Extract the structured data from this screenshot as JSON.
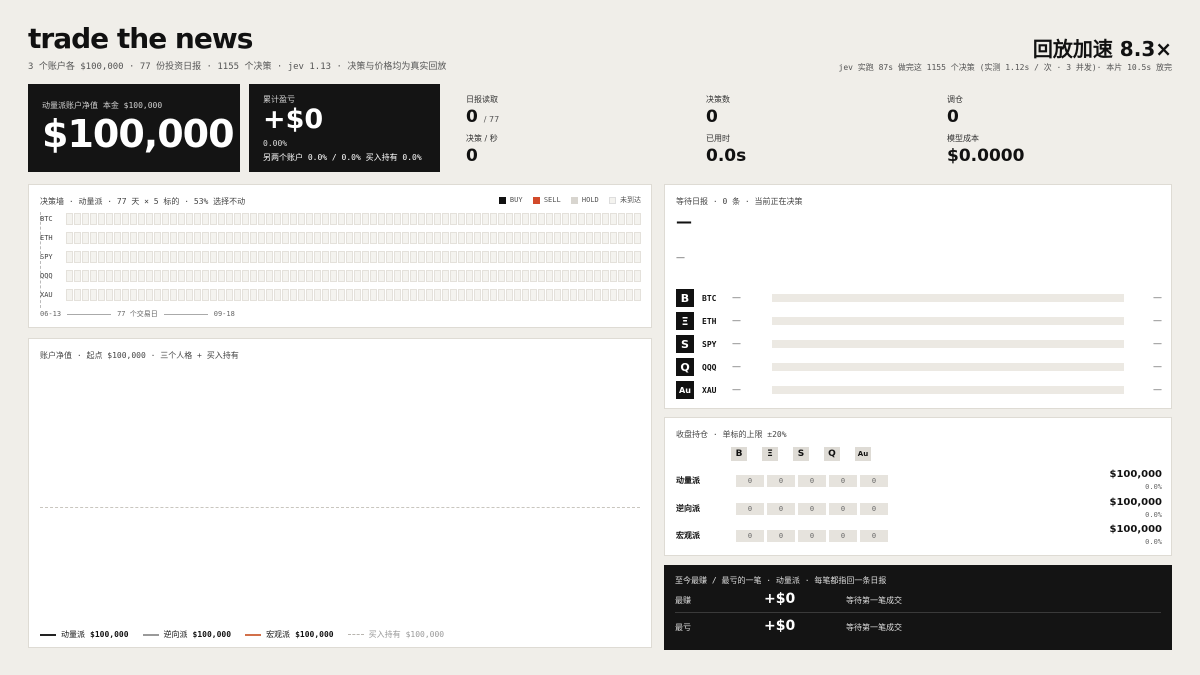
{
  "header": {
    "title": "trade the news",
    "subtitle": "3 个账户各 $100,000 · 77 份投资日报 · 1155 个决策 · jev 1.13 · 决策与价格均为真实回放",
    "speed": "回放加速 8.3×",
    "speed_sub": "jev 实跑 87s 做完这 1155 个决策 (实测 1.12s / 次 · 3 并发)· 本片 10.5s 放完"
  },
  "kpi": {
    "equity_label": "动量派账户净值   本金 $100,000",
    "equity_value": "$100,000",
    "pnl_label": "累计盈亏",
    "pnl_value": "+$0",
    "pnl_pct": "0.00%",
    "pnl_compare": "另两个账户 0.0% / 0.0%   买入持有 0.0%"
  },
  "stats": [
    {
      "label": "日报读取",
      "value": "0",
      "unit": "/ 77"
    },
    {
      "label": "决策数",
      "value": "0",
      "unit": ""
    },
    {
      "label": "调仓",
      "value": "0",
      "unit": ""
    },
    {
      "label": "决策 / 秒",
      "value": "0",
      "unit": ""
    },
    {
      "label": "已用时",
      "value": "0.0s",
      "unit": ""
    },
    {
      "label": "模型成本",
      "value": "$0.0000",
      "unit": ""
    }
  ],
  "decision_wall": {
    "title": "决策墙 · 动量派 · 77 天 × 5 标的 · 53% 选择不动",
    "legend": [
      {
        "label": "BUY",
        "color": "#111111"
      },
      {
        "label": "SELL",
        "color": "#d24a2a"
      },
      {
        "label": "HOLD",
        "color": "#d8d5cf"
      },
      {
        "label": "未到达",
        "color": "#f4f3ef"
      }
    ],
    "rows": [
      "BTC",
      "ETH",
      "SPY",
      "QQQ",
      "XAU"
    ],
    "date_start": "06-13",
    "date_mid": "77 个交易日",
    "date_end": "09-18"
  },
  "equity_panel": {
    "title": "账户净值 · 起点 $100,000 · 三个人格 + 买入持有",
    "legend": [
      {
        "label": "动量派",
        "value": "$100,000",
        "color": "#222222",
        "style": "solid"
      },
      {
        "label": "逆向派",
        "value": "$100,000",
        "color": "#9a9a9a",
        "style": "solid"
      },
      {
        "label": "宏观派",
        "value": "$100,000",
        "color": "#d2704a",
        "style": "solid"
      },
      {
        "label": "买入持有",
        "value": "$100,000",
        "color": "#b8b5af",
        "style": "dashed"
      }
    ]
  },
  "news_panel": {
    "title": "等待日报 · 0 条 · 当前正在决策",
    "headline": "—",
    "sub": "—",
    "assets": [
      {
        "icon": "B",
        "icon_name": "bitcoin-icon",
        "sym": "BTC",
        "left": "—",
        "right": "—"
      },
      {
        "icon": "Ξ",
        "icon_name": "ethereum-icon",
        "sym": "ETH",
        "left": "—",
        "right": "—"
      },
      {
        "icon": "S",
        "icon_name": "spy-icon",
        "sym": "SPY",
        "left": "—",
        "right": "—"
      },
      {
        "icon": "Q",
        "icon_name": "qqq-icon",
        "sym": "QQQ",
        "left": "—",
        "right": "—"
      },
      {
        "icon": "Au",
        "icon_name": "gold-icon",
        "sym": "XAU",
        "left": "—",
        "right": "—"
      }
    ]
  },
  "holdings": {
    "title": "收盘持仓 · 单标的上限 ±20%",
    "icons": [
      "B",
      "Ξ",
      "S",
      "Q",
      "Au"
    ],
    "rows": [
      {
        "name": "动量派",
        "cells": [
          "0",
          "0",
          "0",
          "0",
          "0"
        ],
        "value": "$100,000",
        "pct": "0.0%"
      },
      {
        "name": "逆向派",
        "cells": [
          "0",
          "0",
          "0",
          "0",
          "0"
        ],
        "value": "$100,000",
        "pct": "0.0%"
      },
      {
        "name": "宏观派",
        "cells": [
          "0",
          "0",
          "0",
          "0",
          "0"
        ],
        "value": "$100,000",
        "pct": "0.0%"
      }
    ]
  },
  "trades": {
    "title": "至今最赚 / 最亏的一笔 · 动量派 · 每笔都指回一条日报",
    "best_label": "最赚",
    "best_value": "+$0",
    "best_note": "等待第一笔成交",
    "worst_label": "最亏",
    "worst_value": "+$0",
    "worst_note": "等待第一笔成交"
  }
}
